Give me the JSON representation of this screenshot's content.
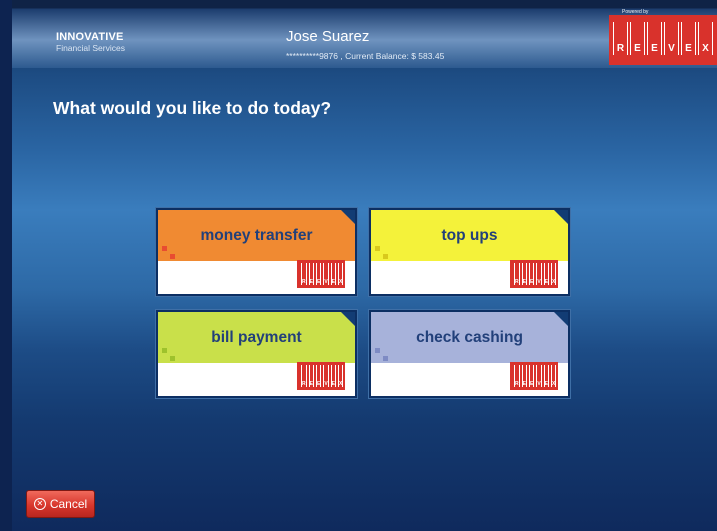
{
  "header": {
    "brand_name": "INNOVATIVE",
    "brand_sub": "Financial Services",
    "user_name": "Jose Suarez",
    "account_line": "**********9876 , Current Balance: $ 583.45",
    "powered_by": "Powered by",
    "logo_letters": [
      "R",
      "E",
      "E",
      "V",
      "E",
      "X"
    ]
  },
  "main": {
    "question": "What would you like to do today?"
  },
  "options": [
    {
      "label": "money transfer",
      "color": "#f08a32",
      "accent": "#e0612a",
      "pixel": "#e84c31"
    },
    {
      "label": "top ups",
      "color": "#f4f23a",
      "accent": "#eaea2c",
      "pixel": "#d9c91c"
    },
    {
      "label": "bill payment",
      "color": "#c9e04a",
      "accent": "#b9d13a",
      "pixel": "#9ec22c"
    },
    {
      "label": "check cashing",
      "color": "#a7b2da",
      "accent": "#949fd0",
      "pixel": "#7e8bc4"
    }
  ],
  "mini_logo_text": "REEVEX",
  "footer": {
    "cancel_label": "Cancel"
  }
}
